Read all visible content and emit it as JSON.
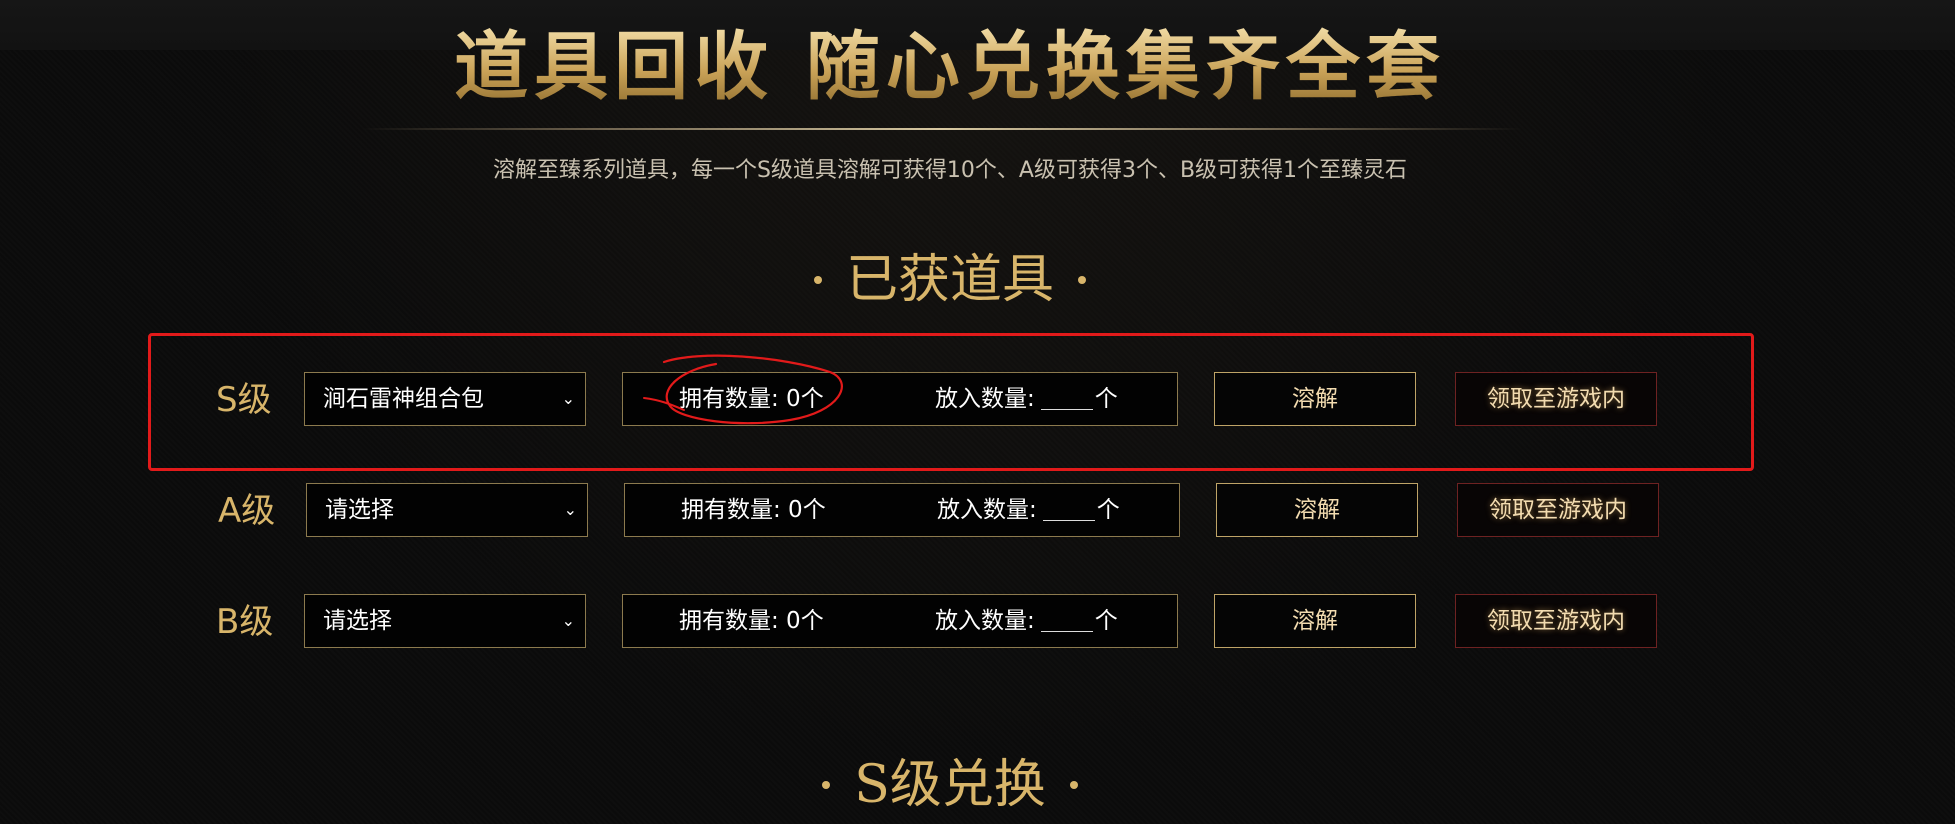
{
  "header": {
    "title": "道具回收  随心兑换集齐全套",
    "subtitle": "溶解至臻系列道具，每一个S级道具溶解可获得10个、A级可获得3个、B级可获得1个至臻灵石"
  },
  "sections": {
    "obtained_title": "已获道具",
    "s_exchange_title": "S级兑换"
  },
  "rows": [
    {
      "grade": "S级",
      "selected": "涧石雷神组合包",
      "owned_label": "拥有数量: 0个",
      "put_label": "放入数量:",
      "put_unit": "个",
      "dissolve": "溶解",
      "claim": "领取至游戏内"
    },
    {
      "grade": "A级",
      "selected": "请选择",
      "owned_label": "拥有数量: 0个",
      "put_label": "放入数量:",
      "put_unit": "个",
      "dissolve": "溶解",
      "claim": "领取至游戏内"
    },
    {
      "grade": "B级",
      "selected": "请选择",
      "owned_label": "拥有数量: 0个",
      "put_label": "放入数量:",
      "put_unit": "个",
      "dissolve": "溶解",
      "claim": "领取至游戏内"
    }
  ],
  "icons": {
    "dropdown": "chevron-down-icon",
    "dot": "bullet-dot-icon"
  },
  "colors": {
    "gold": "#d8b56a",
    "highlight_red": "#e21a1a",
    "background": "#0b0b0b"
  }
}
